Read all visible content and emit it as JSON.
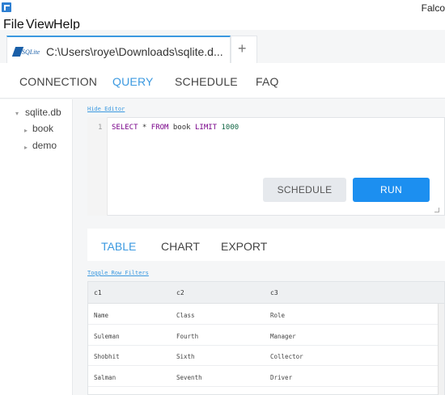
{
  "window": {
    "title": "Falco"
  },
  "menu": {
    "items": [
      "File",
      "View",
      "Help"
    ]
  },
  "connection_tab": {
    "logo_text": "SQLite",
    "label": "C:\\Users\\roye\\Downloads\\sqlite.d...",
    "new_tab_symbol": "+"
  },
  "nav": {
    "items": [
      "CONNECTION",
      "QUERY",
      "SCHEDULE",
      "FAQ"
    ],
    "active": "QUERY"
  },
  "sidebar": {
    "database": {
      "toggle": "▾",
      "label": "sqlite.db"
    },
    "tables": [
      {
        "toggle": "▸",
        "label": "book"
      },
      {
        "toggle": "▸",
        "label": "demo"
      }
    ]
  },
  "editor": {
    "hide_link": "Hide Editor",
    "line_number": "1",
    "query_tokens": [
      {
        "text": "SELECT",
        "kind": "keyword"
      },
      {
        "text": " * ",
        "kind": "plain"
      },
      {
        "text": "FROM",
        "kind": "keyword"
      },
      {
        "text": " book ",
        "kind": "plain"
      },
      {
        "text": "LIMIT",
        "kind": "keyword"
      },
      {
        "text": " ",
        "kind": "plain"
      },
      {
        "text": "1000",
        "kind": "number"
      }
    ],
    "schedule_button": "SCHEDULE",
    "run_button": "RUN"
  },
  "results": {
    "tabs": [
      "TABLE",
      "CHART",
      "EXPORT"
    ],
    "active_tab": "TABLE",
    "toggle_filters_link": "Toggle Row Filters",
    "columns": [
      "c1",
      "c2",
      "c3"
    ],
    "rows": [
      [
        "Name",
        "Class",
        "Role"
      ],
      [
        "Suleman",
        "Fourth",
        "Manager"
      ],
      [
        "Shobhit",
        "Sixth",
        "Collector"
      ],
      [
        "Salman",
        "Seventh",
        "Driver"
      ]
    ]
  },
  "colors": {
    "accent": "#3b99e0",
    "run_button": "#1c8ff0",
    "keyword": "#770088",
    "number": "#116644"
  }
}
